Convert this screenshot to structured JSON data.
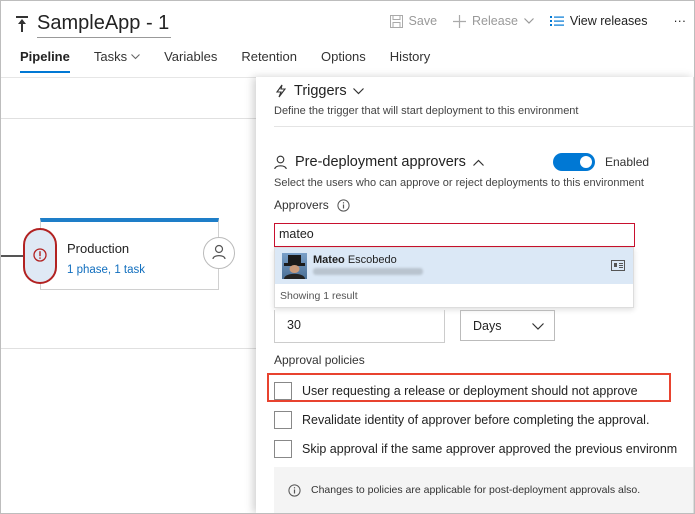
{
  "header": {
    "title": "SampleApp - 1",
    "toolbar": {
      "save_label": "Save",
      "release_label": "Release",
      "view_releases_label": "View releases",
      "more_label": "···"
    },
    "tabs": [
      {
        "label": "Pipeline",
        "selected": true
      },
      {
        "label": "Tasks",
        "has_dropdown": true
      },
      {
        "label": "Variables"
      },
      {
        "label": "Retention"
      },
      {
        "label": "Options"
      },
      {
        "label": "History"
      }
    ]
  },
  "pipeline": {
    "environment": {
      "name": "Production",
      "subtitle": "1 phase, 1 task"
    }
  },
  "panel": {
    "triggers": {
      "title": "Triggers",
      "description": "Define the trigger that will start deployment to this environment"
    },
    "pre_deployment": {
      "title": "Pre-deployment approvers",
      "toggle_label": "Enabled",
      "toggle_on": true,
      "description": "Select the users who can approve or reject deployments to this environment"
    },
    "approvers": {
      "label": "Approvers",
      "input_value": "mateo",
      "result": {
        "first_name": "Mateo",
        "last_name": "Escobedo"
      },
      "showing_text": "Showing 1 result"
    },
    "timeout": {
      "value": "30",
      "unit": "Days"
    },
    "approval_policies": {
      "label": "Approval policies",
      "options": [
        {
          "label": "User requesting a release or deployment should not approve",
          "checked": false
        },
        {
          "label": "Revalidate identity of approver before completing the approval.",
          "checked": false
        },
        {
          "label": "Skip approval if the same approver approved the previous environm",
          "checked": false
        }
      ]
    },
    "info_text": "Changes to policies are applicable for post-deployment approvals also."
  },
  "colors": {
    "accent": "#0078d4",
    "highlight_border": "#e8432f",
    "warning": "#b22222"
  }
}
